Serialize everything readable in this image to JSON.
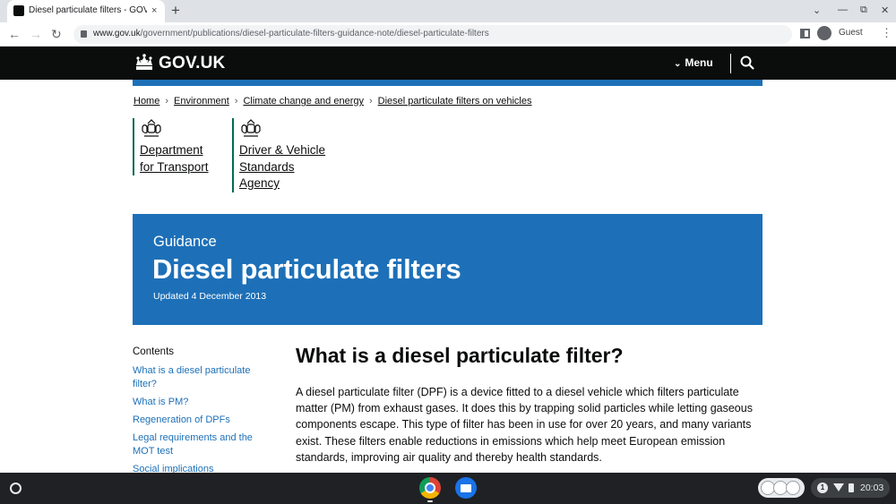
{
  "browser": {
    "tab_title": "Diesel particulate filters - GOV.UK",
    "tab_close": "×",
    "new_tab": "+",
    "url_host": "www.gov.uk",
    "url_path": "/government/publications/diesel-particulate-filters-guidance-note/diesel-particulate-filters",
    "profile_label": "Guest",
    "win_controls": [
      "⌄",
      "—",
      "⧉",
      "✕"
    ],
    "back": "←",
    "forward": "→",
    "reload": "↻",
    "menu": "⋮"
  },
  "govuk_header": {
    "logo_text": "GOV.UK",
    "menu_label": "Menu",
    "chevron": "⌄"
  },
  "breadcrumbs": [
    "Home",
    "Environment",
    "Climate change and energy",
    "Diesel particulate filters on vehicles"
  ],
  "breadcrumb_separator": "›",
  "organisations": [
    {
      "lines": [
        "Department",
        "for Transport"
      ],
      "brand_color": "#006c56"
    },
    {
      "lines": [
        "Driver & Vehicle",
        "Standards",
        "Agency"
      ],
      "brand_color": "#006c56"
    }
  ],
  "banner": {
    "kicker": "Guidance",
    "title": "Diesel particulate filters",
    "updated": "Updated 4 December 2013",
    "background": "#1d70b8"
  },
  "contents": {
    "heading": "Contents",
    "items": [
      "What is a diesel particulate filter?",
      "What is PM?",
      "Regeneration of DPFs",
      "Legal requirements and the MOT test",
      "Social implications"
    ]
  },
  "article": {
    "heading": "What is a diesel particulate filter?",
    "paragraph": "A diesel particulate filter (DPF) is a device fitted to a diesel vehicle which filters particulate matter (PM) from exhaust gases. It does this by trapping solid particles while letting gaseous components escape. This type of filter has been in use for over 20 years, and many variants exist. These filters enable reductions in emissions which help meet European emission standards, improving air quality and thereby health standards."
  },
  "shelf": {
    "notification_count": "1",
    "time": "20:03",
    "apps": [
      "chrome-icon",
      "files-icon"
    ]
  },
  "colors": {
    "govuk_black": "#0b0c0c",
    "govuk_blue": "#1d70b8",
    "link": "#1d70b8"
  }
}
